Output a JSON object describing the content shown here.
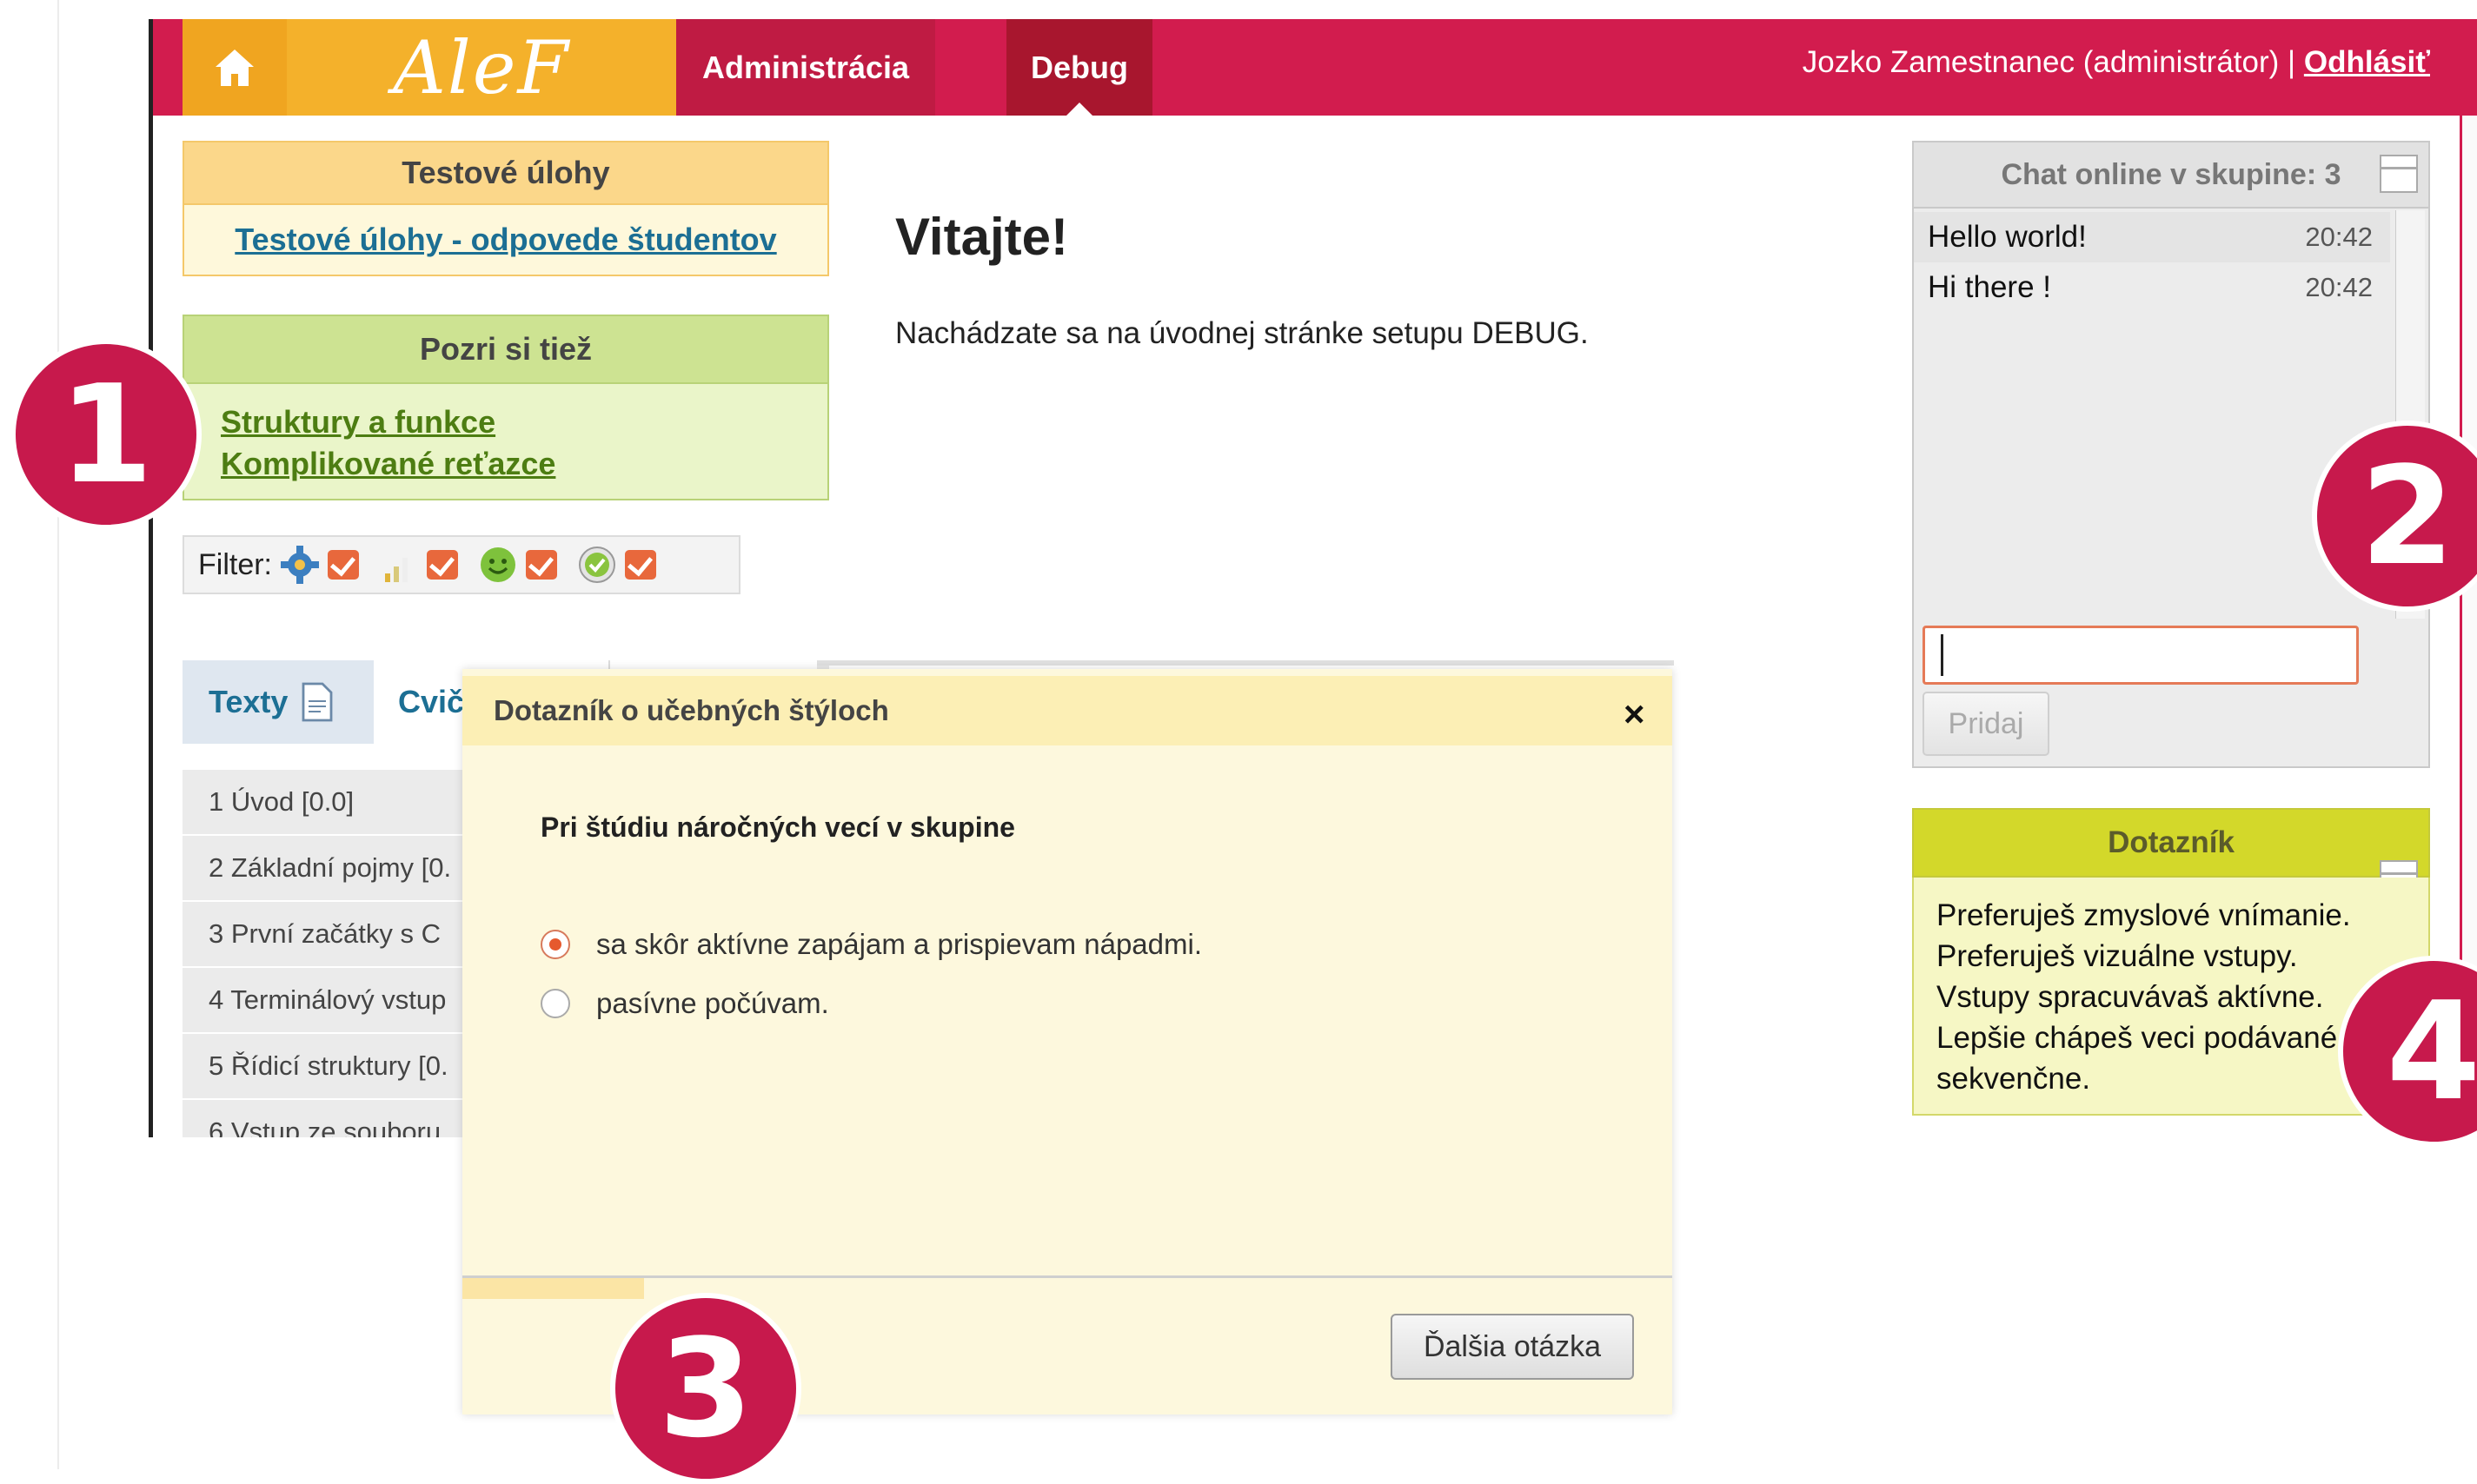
{
  "header": {
    "logo": "AleF",
    "nav": [
      {
        "label": "Administrácia"
      },
      {
        "label": "Debug"
      }
    ],
    "user": "Jozko Zamestnanec (administrátor) |",
    "logout": "Odhlásiť"
  },
  "sidebar": {
    "tasks": {
      "title": "Testové úlohy",
      "link": "Testové úlohy - odpovede študentov"
    },
    "see_also": {
      "title": "Pozri si tiež",
      "links": [
        "Struktury a funkce",
        "Komplikované reťazce"
      ]
    },
    "filter_label": "Filter:",
    "tabs": [
      {
        "label": "Texty"
      },
      {
        "label": "Cvič"
      }
    ],
    "list": [
      "1 Úvod [0.0]",
      "2 Základní pojmy [0.",
      "3 První začátky s C",
      "4 Terminálový vstup",
      "5 Řídicí struktury [0.",
      "6 Vstup ze souboru"
    ]
  },
  "main": {
    "title": "Vitajte!",
    "text": "Nachádzate sa na úvodnej stránke setupu DEBUG."
  },
  "modal": {
    "title": "Dotazník o učebných štýloch",
    "close": "×",
    "question": "Pri štúdiu náročných vecí v skupine",
    "options": [
      {
        "label": "sa skôr aktívne zapájam a prispievam nápadmi.",
        "selected": true
      },
      {
        "label": "pasívne počúvam.",
        "selected": false
      }
    ],
    "next_label": "Ďalšia otázka",
    "progress": 0.15
  },
  "chat": {
    "title": "Chat online v skupine: 3",
    "messages": [
      {
        "text": "Hello world!",
        "time": "20:42"
      },
      {
        "text": "Hi there !",
        "time": "20:42"
      }
    ],
    "input_value": "",
    "send_label": "Pridaj"
  },
  "questionnaire": {
    "title": "Dotazník",
    "lines": [
      "Preferuješ zmyslové vnímanie.",
      "Preferuješ vizuálne vstupy.",
      "Vstupy spracuvávaš aktívne.",
      "Lepšie chápeš veci podávané",
      "sekvenčne."
    ]
  },
  "badges": [
    "1",
    "2",
    "3",
    "4"
  ],
  "colors": {
    "brand": "#d21c4e",
    "accent": "#f4b12b",
    "badge": "#c7194c"
  }
}
